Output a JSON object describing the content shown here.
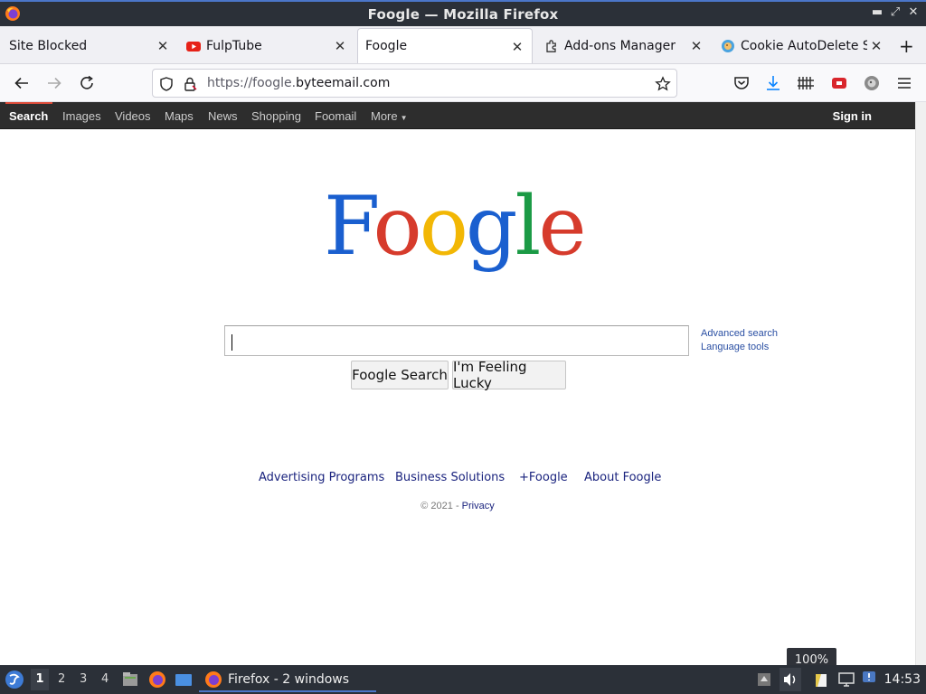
{
  "window": {
    "title": "Foogle — Mozilla Firefox"
  },
  "tabs": [
    {
      "label": "Site Blocked",
      "favicon": "none"
    },
    {
      "label": "FulpTube",
      "favicon": "youtube-icon"
    },
    {
      "label": "Foogle",
      "favicon": "none",
      "selected": true
    },
    {
      "label": "Add-ons Manager",
      "favicon": "puzzle-icon"
    },
    {
      "label": "Cookie AutoDelete S",
      "favicon": "cookie-icon"
    }
  ],
  "navbar": {
    "url_scheme": "https://foogle.",
    "url_domain": "byteemail.com"
  },
  "foogle_bar": {
    "links": [
      "Search",
      "Images",
      "Videos",
      "Maps",
      "News",
      "Shopping",
      "Foomail",
      "More"
    ],
    "signin": "Sign in"
  },
  "logo": {
    "text": "Foogle",
    "letter_colors": [
      "#1a5fcf",
      "#d63b2c",
      "#f2b705",
      "#1a5fcf",
      "#1b9a45",
      "#d63b2c"
    ]
  },
  "search": {
    "value": "",
    "advanced_link": "Advanced search",
    "language_link": "Language tools",
    "search_button": "Foogle Search",
    "lucky_button": "I'm Feeling Lucky"
  },
  "footer": {
    "links": [
      "Advertising Programs",
      "Business Solutions",
      "+Foogle",
      "About Foogle"
    ],
    "copyright": "© 2021 - ",
    "privacy": "Privacy"
  },
  "zoom_tooltip": "100%",
  "taskbar": {
    "workspaces": [
      "1",
      "2",
      "3",
      "4"
    ],
    "active_workspace": "1",
    "window_button": "Firefox - 2 windows",
    "clock": "14:53"
  }
}
